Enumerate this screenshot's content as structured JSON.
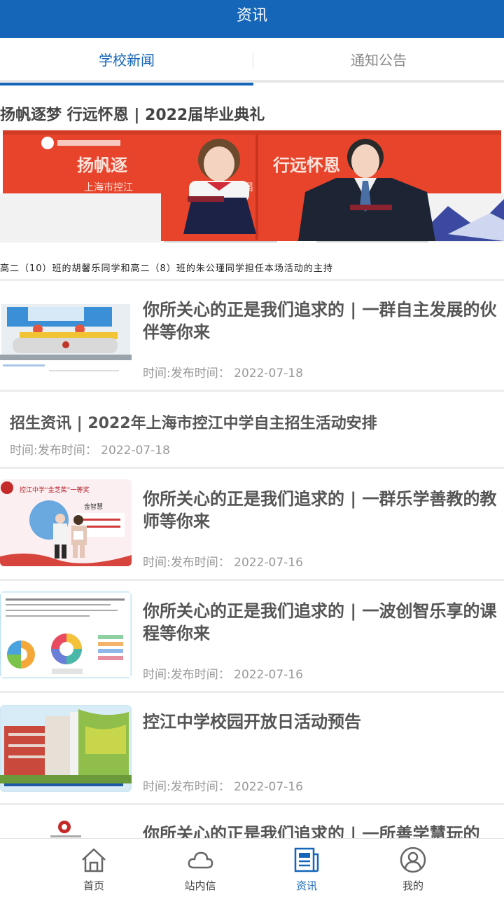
{
  "header": {
    "title": "资讯"
  },
  "tabs": [
    {
      "label": "学校新闻",
      "active": true
    },
    {
      "label": "通知公告",
      "active": false
    }
  ],
  "feature": {
    "title": "扬帆逐梦 行远怀恩 | 2022届毕业典礼",
    "banner_text_left": "扬帆逐",
    "banner_text_right": "行远怀恩",
    "banner_subtext": "上海市控江",
    "banner_year": "22届",
    "caption": "高二（10）班的胡馨乐同学和高二（8）班的朱公瑾同学担任本场活动的主持"
  },
  "news": [
    {
      "title": "你所关心的正是我们追求的 | 一群自主发展的伙伴等你来",
      "time": "时间:发布时间：  2022-07-18",
      "has_thumb": true
    },
    {
      "title": "招生资讯 | 2022年上海市控江中学自主招生活动安排",
      "time": "时间:发布时间：  2022-07-18",
      "has_thumb": false
    },
    {
      "title": "你所关心的正是我们追求的 | 一群乐学善教的教师等你来",
      "time": "时间:发布时间：  2022-07-16",
      "has_thumb": true,
      "thumb_text": "控江中学“金芝茱”一等奖",
      "thumb_name": "金智慧"
    },
    {
      "title": "你所关心的正是我们追求的 | 一波创智乐享的课程等你来",
      "time": "时间:发布时间：  2022-07-16",
      "has_thumb": true
    },
    {
      "title": "控江中学校园开放日活动预告",
      "time": "时间:发布时间：  2022-07-16",
      "has_thumb": true
    },
    {
      "title": "你所关心的正是我们追求的 | 一所善学慧玩的",
      "time": "",
      "has_thumb": true
    }
  ],
  "bottom_nav": [
    {
      "label": "首页",
      "icon": "home-icon",
      "active": false
    },
    {
      "label": "站内信",
      "icon": "cloud-icon",
      "active": false
    },
    {
      "label": "资讯",
      "icon": "news-icon",
      "active": true
    },
    {
      "label": "我的",
      "icon": "profile-icon",
      "active": false
    }
  ],
  "colors": {
    "primary": "#1565b8",
    "banner_red": "#e8442c",
    "text_muted": "#999999"
  }
}
